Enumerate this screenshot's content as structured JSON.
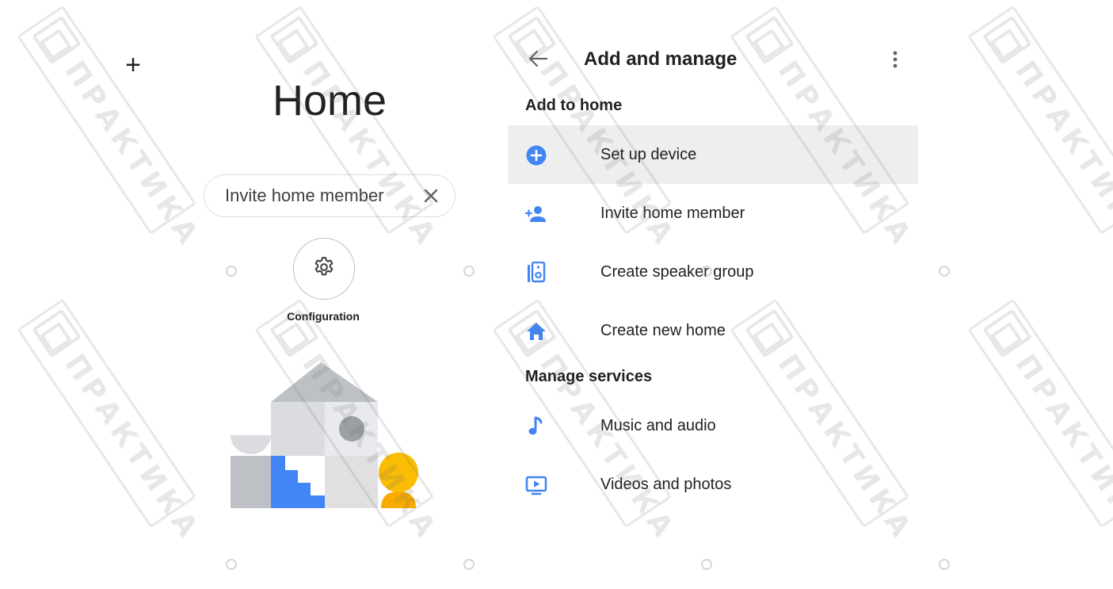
{
  "left_panel": {
    "add_icon": "plus-icon",
    "title": "Home",
    "invite_chip": {
      "label": "Invite home member",
      "close_icon": "close-icon"
    },
    "configuration": {
      "icon": "gear-icon",
      "label": "Configuration"
    },
    "illustration": "house-illustration"
  },
  "right_panel": {
    "back_icon": "arrow-back-icon",
    "title": "Add and manage",
    "more_icon": "more-vert-icon",
    "sections": [
      {
        "header": "Add to home",
        "items": [
          {
            "label": "Set up device",
            "icon": "add-circle-icon",
            "highlighted": true
          },
          {
            "label": "Invite home member",
            "icon": "person-add-icon"
          },
          {
            "label": "Create speaker group",
            "icon": "speaker-icon"
          },
          {
            "label": "Create new home",
            "icon": "home-icon"
          }
        ]
      },
      {
        "header": "Manage services",
        "items": [
          {
            "label": "Music and audio",
            "icon": "music-note-icon"
          },
          {
            "label": "Videos and photos",
            "icon": "video-icon"
          }
        ]
      }
    ]
  },
  "watermark": {
    "text": "ПРАКТИКА"
  },
  "colors": {
    "accent": "#4285f4",
    "highlight_row": "#eeeeee",
    "text": "#202124",
    "yellow": "#fbbc04",
    "gray": "#bdc1c6"
  }
}
